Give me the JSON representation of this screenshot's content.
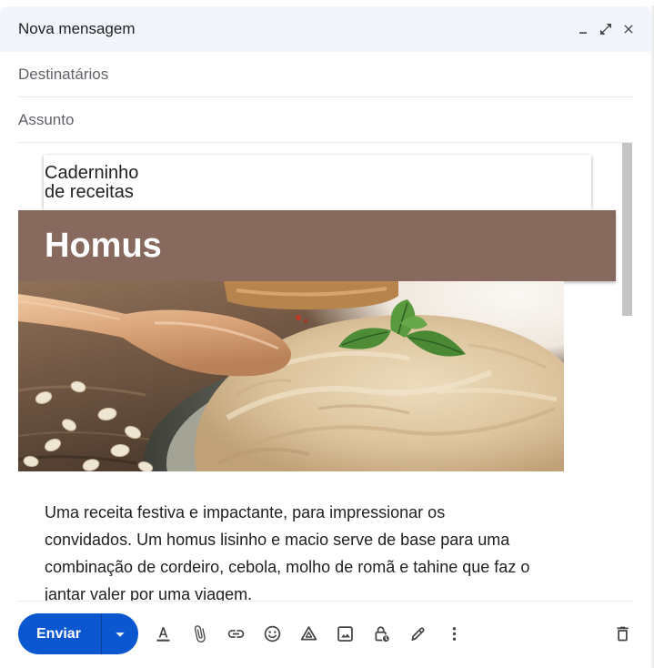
{
  "window": {
    "title": "Nova mensagem",
    "minimize_icon": "minimize-icon",
    "fullscreen_icon": "fullscreen-icon",
    "close_icon": "close-icon"
  },
  "fields": {
    "recipients": {
      "value": "",
      "placeholder": "Destinatários"
    },
    "subject": {
      "value": "",
      "placeholder": "Assunto"
    }
  },
  "message": {
    "card_lines": [
      "Caderninho",
      "de receitas"
    ],
    "banner_title": "Homus",
    "paragraph_lines": [
      "Uma receita festiva e impactante, para impressionar os",
      "convidados. Um homus lisinho e macio serve de base para uma",
      "combinação de cordeiro, cebola, molho de romã e tahine que faz o",
      "jantar valer por uma viagem."
    ]
  },
  "toolbar": {
    "send_label": "Enviar",
    "send_options_icon": "dropdown-arrow-icon",
    "tools": [
      {
        "icon": "format-text-icon"
      },
      {
        "icon": "attach-file-icon"
      },
      {
        "icon": "insert-link-icon"
      },
      {
        "icon": "emoji-icon"
      },
      {
        "icon": "drive-icon"
      },
      {
        "icon": "insert-photo-icon"
      },
      {
        "icon": "confidential-mode-icon"
      },
      {
        "icon": "signature-icon"
      },
      {
        "icon": "more-options-icon"
      }
    ],
    "delete_icon": "delete-icon"
  },
  "colors": {
    "accent": "#0b57d0",
    "header_bg": "#f2f6fc",
    "banner_bg": "#876a5d",
    "text": "#1f1f1f",
    "placeholder": "#5f6368",
    "icon": "#444746"
  }
}
